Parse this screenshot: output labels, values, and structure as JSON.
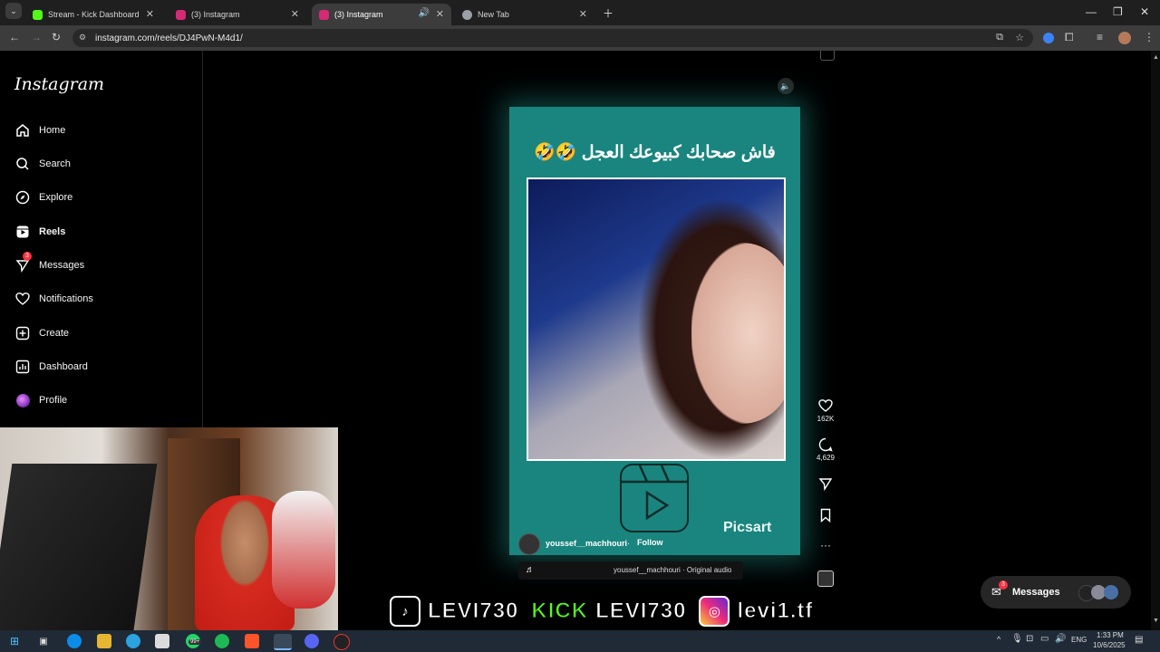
{
  "browser": {
    "tabs": [
      {
        "title": "Stream - Kick Dashboard",
        "favicon_color": "#53fc18"
      },
      {
        "title": "(3) Instagram",
        "favicon_color": "#d62976"
      },
      {
        "title": "(3) Instagram",
        "favicon_color": "#d62976"
      },
      {
        "title": "New Tab",
        "favicon_color": "#9aa0a6"
      }
    ],
    "url": "instagram.com/reels/DJ4PwN-M4d1/"
  },
  "sidebar": {
    "logo": "Instagram",
    "items": [
      {
        "label": "Home",
        "icon": "home-icon"
      },
      {
        "label": "Search",
        "icon": "search-icon"
      },
      {
        "label": "Explore",
        "icon": "explore-icon"
      },
      {
        "label": "Reels",
        "icon": "reels-icon"
      },
      {
        "label": "Messages",
        "icon": "messages-icon",
        "badge": "3"
      },
      {
        "label": "Notifications",
        "icon": "heart-icon"
      },
      {
        "label": "Create",
        "icon": "plus-icon"
      },
      {
        "label": "Dashboard",
        "icon": "dashboard-icon"
      },
      {
        "label": "Profile",
        "icon": "avatar-icon"
      }
    ]
  },
  "reel": {
    "caption": "فاش صحابك كبيوعك العجل 🤣🤣",
    "watermark": "Picsart",
    "author": "youssef__machhouri",
    "follow_label": "Follow",
    "audio": "youssef__machhouri · Original audio",
    "likes": "162K",
    "comments": "4,629"
  },
  "overlay": {
    "tiktok": "LEVI730",
    "kick_label": "KICK",
    "kick_name": "LEVI730",
    "instagram": "levi1.tf"
  },
  "messages_pill": {
    "label": "Messages",
    "badge": "3"
  },
  "taskbar": {
    "lang": "ENG",
    "time": "1:33 PM",
    "date": "10/6/2025",
    "whatsapp_badge": "99+"
  },
  "colors": {
    "reel_bg": "#1a857e",
    "kick_green": "#53fc18",
    "badge_red": "#ff3040"
  }
}
